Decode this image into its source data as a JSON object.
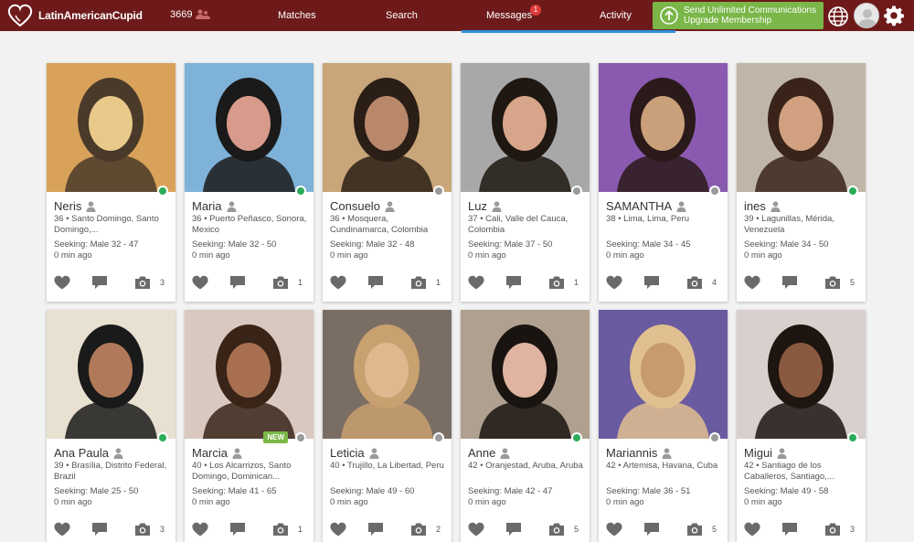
{
  "brand": {
    "name": "LatinAmericanCupid"
  },
  "header": {
    "online_count": "3669",
    "nav": {
      "matches": "Matches",
      "search": "Search",
      "messages": "Messages",
      "activity": "Activity"
    },
    "messages_badge": "1",
    "upgrade": {
      "line1": "Send Unlimited Communications",
      "line2": "Upgrade Membership"
    }
  },
  "colors": {
    "header_bg": "#6e1a1a",
    "upgrade_green": "#7ab648",
    "online": "#2bab5a",
    "offline": "#9a9a9a",
    "accent_blue": "#2f8fd8"
  },
  "profiles": [
    {
      "name": "Neris",
      "location": "36 • Santo Domingo, Santo Domingo,...",
      "seeking": "Seeking: Male 32 - 47",
      "last_seen": "0 min ago",
      "photos": "3",
      "status": "online",
      "badge": ""
    },
    {
      "name": "Maria",
      "location": "36 • Puerto Peñasco, Sonora, Mexico",
      "seeking": "Seeking: Male 32 - 50",
      "last_seen": "0 min ago",
      "photos": "1",
      "status": "online",
      "badge": ""
    },
    {
      "name": "Consuelo",
      "location": "36 • Mosquera, Cundinamarca, Colombia",
      "seeking": "Seeking: Male 32 - 48",
      "last_seen": "0 min ago",
      "photos": "1",
      "status": "offline",
      "badge": ""
    },
    {
      "name": "Luz",
      "location": "37 • Cali, Valle del Cauca, Colombia",
      "seeking": "Seeking: Male 37 - 50",
      "last_seen": "0 min ago",
      "photos": "1",
      "status": "offline",
      "badge": ""
    },
    {
      "name": "SAMANTHA",
      "location": "38 • Lima, Lima, Peru",
      "seeking": "Seeking: Male 34 - 45",
      "last_seen": "0 min ago",
      "photos": "4",
      "status": "offline",
      "badge": ""
    },
    {
      "name": "ines",
      "location": "39 • Lagunillas, Mérida, Venezuela",
      "seeking": "Seeking: Male 34 - 50",
      "last_seen": "0 min ago",
      "photos": "5",
      "status": "online",
      "badge": ""
    },
    {
      "name": "Ana Paula",
      "location": "39 • Brasília, Distrito Federal, Brazil",
      "seeking": "Seeking: Male 25 - 50",
      "last_seen": "0 min ago",
      "photos": "3",
      "status": "online",
      "badge": ""
    },
    {
      "name": "Marcia",
      "location": "40 • Los Alcarrizos, Santo Domingo, Dominican...",
      "seeking": "Seeking: Male 41 - 65",
      "last_seen": "0 min ago",
      "photos": "1",
      "status": "offline",
      "badge": "NEW"
    },
    {
      "name": "Leticia",
      "location": "40 • Trujillo, La Libertad, Peru",
      "seeking": "Seeking: Male 49 - 60",
      "last_seen": "0 min ago",
      "photos": "2",
      "status": "offline",
      "badge": ""
    },
    {
      "name": "Anne",
      "location": "42 • Oranjestad, Aruba, Aruba",
      "seeking": "Seeking: Male 42 - 47",
      "last_seen": "0 min ago",
      "photos": "5",
      "status": "online",
      "badge": ""
    },
    {
      "name": "Mariannis",
      "location": "42 • Artemisa, Havana, Cuba",
      "seeking": "Seeking: Male 36 - 51",
      "last_seen": "0 min ago",
      "photos": "5",
      "status": "offline",
      "badge": ""
    },
    {
      "name": "Migui",
      "location": "42 • Santiago de los Caballeros, Santiago,...",
      "seeking": "Seeking: Male 49 - 58",
      "last_seen": "0 min ago",
      "photos": "3",
      "status": "online",
      "badge": ""
    }
  ]
}
